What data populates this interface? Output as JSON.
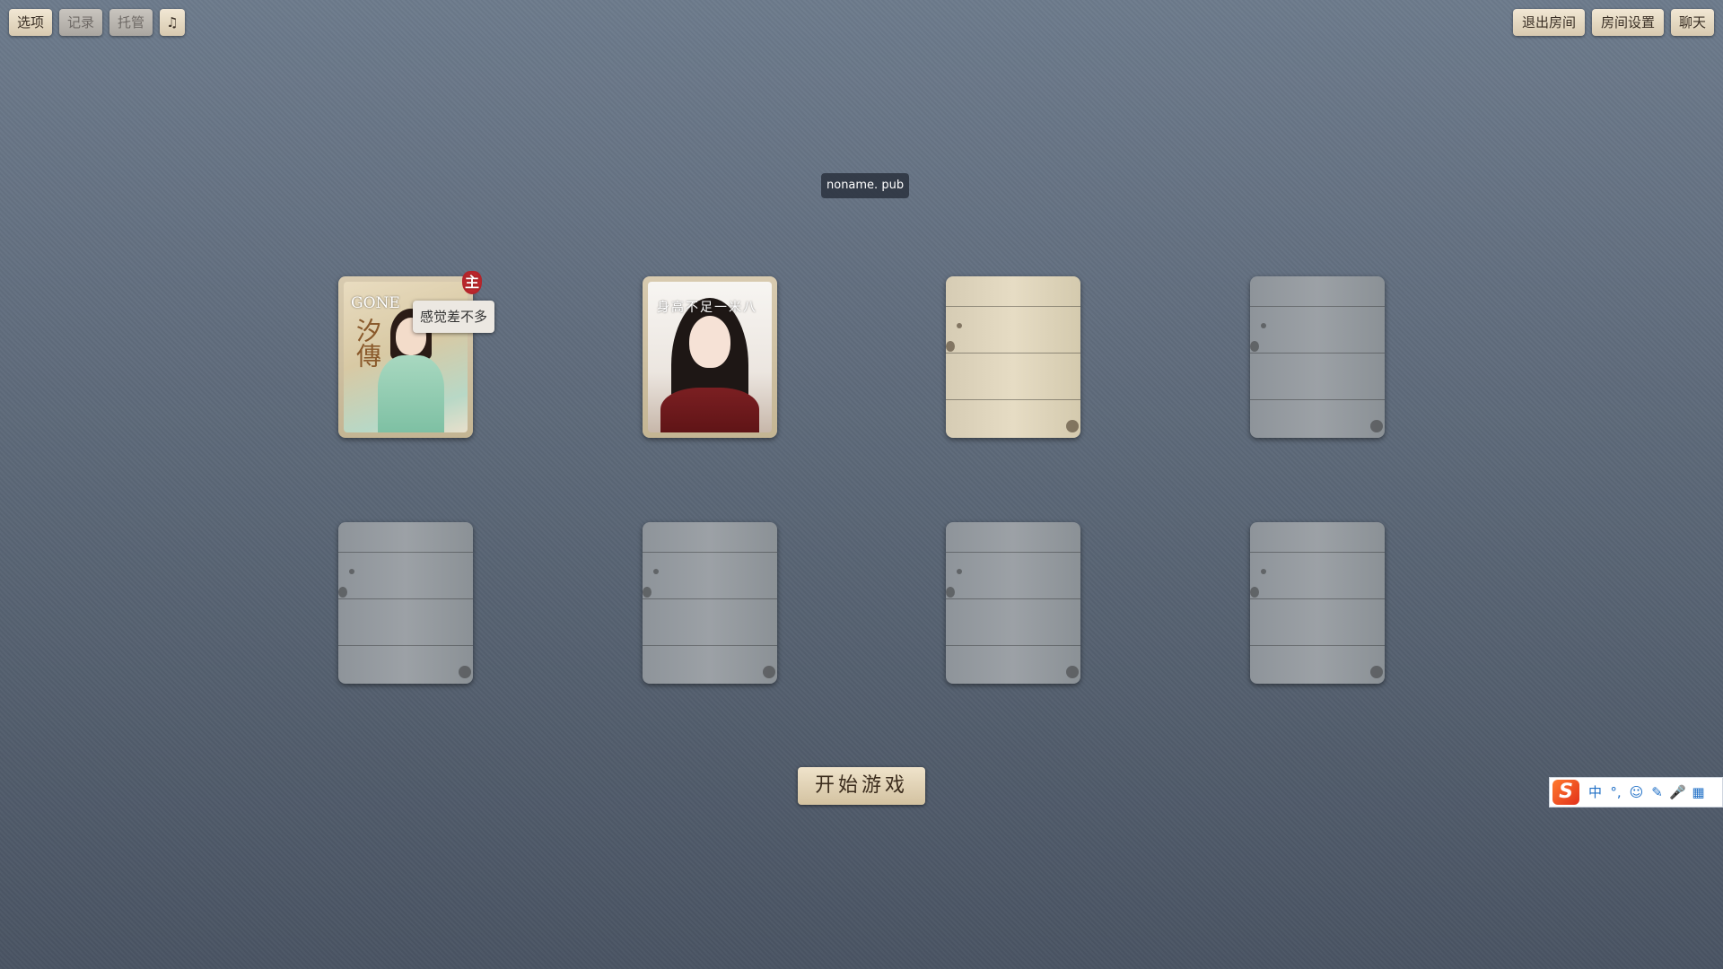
{
  "toolbar_left": {
    "options_label": "选项",
    "record_label": "记录",
    "auto_label": "托管",
    "music_icon": "♫"
  },
  "toolbar_right": {
    "leave_room_label": "退出房间",
    "room_settings_label": "房间设置",
    "chat_label": "聊天"
  },
  "server_label": "noname. pub",
  "seats": [
    {
      "status": "occupied",
      "host": true,
      "host_badge": "主",
      "card_title": "GONE",
      "card_subtitle": "汐傳",
      "chat_bubble": "感觉差不多"
    },
    {
      "status": "occupied",
      "host": false,
      "card_caption": "身高不足一米八"
    },
    {
      "status": "empty",
      "tone": "light"
    },
    {
      "status": "empty",
      "tone": "gray"
    },
    {
      "status": "empty",
      "tone": "gray"
    },
    {
      "status": "empty",
      "tone": "gray"
    },
    {
      "status": "empty",
      "tone": "gray"
    },
    {
      "status": "empty",
      "tone": "gray"
    }
  ],
  "start_button_label": "开始游戏",
  "ime": {
    "logo": "S",
    "items": [
      "中",
      "°,",
      "☺",
      "✎",
      "🎤",
      "▦"
    ]
  },
  "colors": {
    "button_bg": "#e6dbc4",
    "host_badge": "#c0262d",
    "ime_logo": "#f05a24"
  }
}
